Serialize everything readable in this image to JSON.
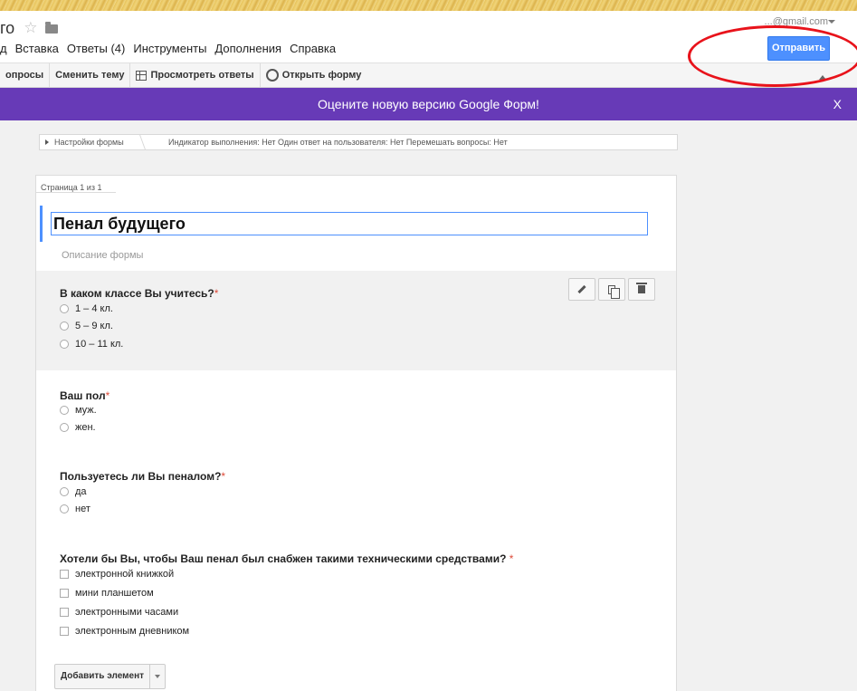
{
  "header": {
    "title_fragment": "го",
    "account": "...@gmail.com",
    "menu": [
      {
        "label": "д"
      },
      {
        "label": "Вставка"
      },
      {
        "label": "Ответы (4)"
      },
      {
        "label": "Инструменты"
      },
      {
        "label": "Дополнения"
      },
      {
        "label": "Справка"
      }
    ],
    "send_label": "Отправить"
  },
  "toolbar": {
    "questions_label": "опросы",
    "theme_label": "Сменить тему",
    "responses_label": "Просмотреть ответы",
    "open_form_label": "Открыть форму"
  },
  "banner": {
    "text": "Оцените новую версию Google Форм!",
    "close": "X"
  },
  "settings": {
    "label": "Настройки формы",
    "summary": "Индикатор выполнения: Нет   Один ответ на пользователя: Нет   Перемешать вопросы: Нет"
  },
  "form": {
    "page_label": "Страница 1 из 1",
    "title": "Пенал будущего",
    "description_placeholder": "Описание формы",
    "questions": [
      {
        "title": "В каком классе Вы учитесь?",
        "required": "*",
        "options": [
          "1 – 4 кл.",
          "5 – 9 кл.",
          "10 – 11 кл."
        ]
      },
      {
        "title": "Ваш пол",
        "required": "*",
        "options": [
          "муж.",
          "жен."
        ]
      },
      {
        "title": "Пользуетесь ли Вы пеналом?",
        "required": "*",
        "options": [
          "да",
          "нет"
        ]
      },
      {
        "title": "Хотели бы Вы, чтобы Ваш пенал был снабжен такими техническими средствами? ",
        "required": "*",
        "options": [
          "электронной книжкой",
          "мини планшетом",
          "электронными часами",
          "электронным дневником"
        ]
      }
    ],
    "add_item_label": "Добавить элемент"
  }
}
